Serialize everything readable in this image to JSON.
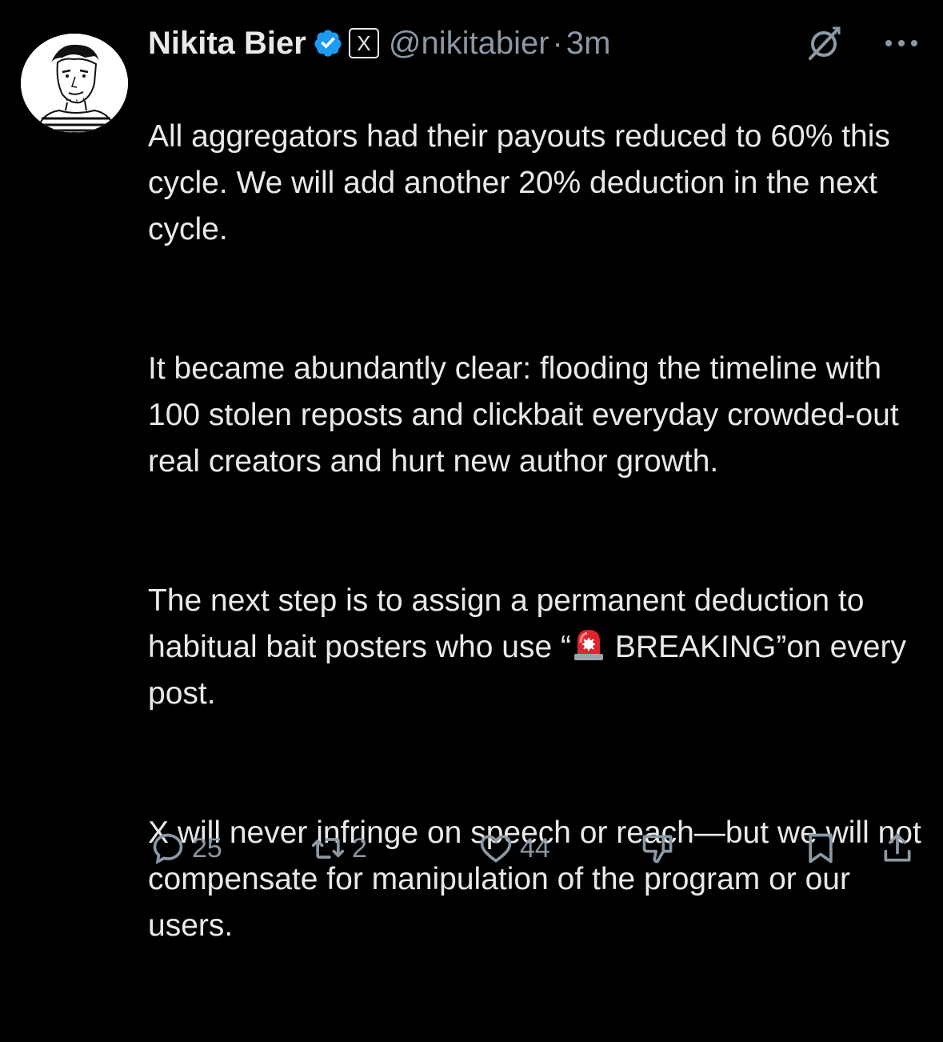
{
  "post": {
    "author_name": "Nikita Bier",
    "author_handle": "@nikitabier",
    "separator": "·",
    "timestamp": "3m",
    "affiliate_badge": "X",
    "paragraphs": [
      "All aggregators had their payouts reduced to 60% this cycle. We will add another 20% deduction in the next cycle.",
      "It became abundantly clear: flooding the timeline with 100 stolen reposts and clickbait everyday crowded-out real creators and hurt new author growth.",
      "X will never infringe on speech or reach—but we will not compensate for manipulation of the program or our users."
    ],
    "paragraph3_before": "The next step is to assign a permanent deduction to habitual bait posters who use “",
    "paragraph3_after": " BREAKING”on every post."
  },
  "icons": {
    "verified": "verified-badge-icon",
    "grok": "grok-icon",
    "more": "more-icon",
    "siren": "police-light-emoji",
    "reply": "reply-icon",
    "repost": "repost-icon",
    "like": "like-icon",
    "dislike": "dislike-icon",
    "bookmark": "bookmark-icon",
    "share": "share-icon"
  },
  "actions": {
    "replies": "25",
    "reposts": "2",
    "likes": "44"
  },
  "colors": {
    "background": "#000000",
    "text": "#e7e9ea",
    "secondary": "#8b98a5",
    "verified": "#1d9bf0"
  }
}
